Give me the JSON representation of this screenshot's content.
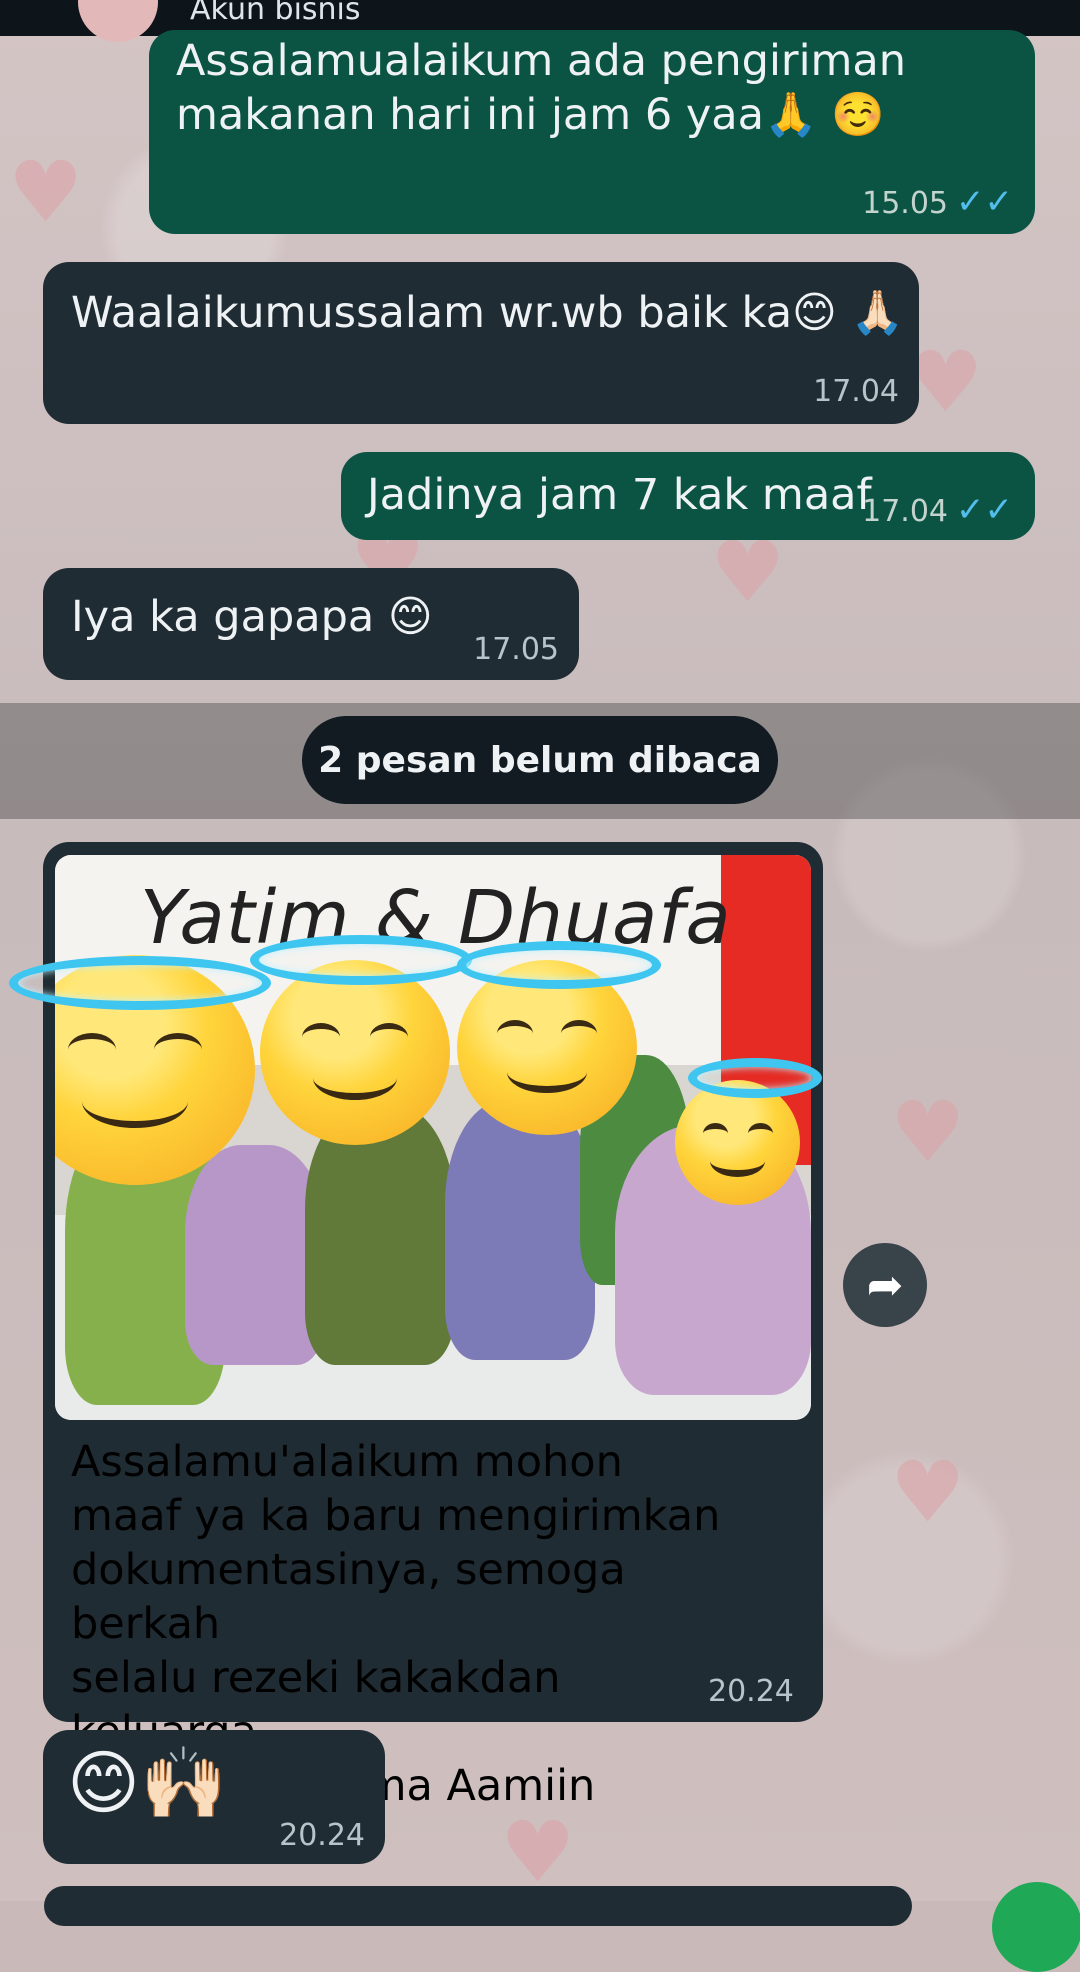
{
  "header": {
    "subtitle": "Akun bisnis"
  },
  "messages": [
    {
      "direction": "out",
      "text": "Assalamualaikum ada pengiriman makanan hari ini jam 6 yaa🙏 ☺️",
      "time": "15.05",
      "status": "read"
    },
    {
      "direction": "in",
      "text": "Waalaikumussalam wr.wb baik ka😊 🙏🏻",
      "time": "17.04"
    },
    {
      "direction": "out",
      "text": "Jadinya jam 7 kak maaf",
      "time": "17.04",
      "status": "read"
    },
    {
      "direction": "in",
      "text": "Iya ka gapapa 😊",
      "time": "17.05"
    }
  ],
  "unread_divider": "2 pesan belum dibaca",
  "photo_message": {
    "banner_text": "Yatim & Dhuafa",
    "caption_lines": [
      "Assalamu'alaikum mohon",
      "maaf ya ka baru mengirimkan",
      "dokumentasinya, semoga berkah",
      "selalu rezeki kakakdan keluarga.",
      "Aamiin allahuma Aamiin"
    ],
    "time": "20.24"
  },
  "last_message": {
    "text": "😊🙌🏻",
    "time": "20.24"
  },
  "icons": {
    "forward": "forward-icon",
    "read_ticks": "double-check-icon",
    "send": "send-icon"
  },
  "colors": {
    "incoming_bubble": "#202c33",
    "outgoing_bubble": "#0b5443",
    "read_tick": "#53bdeb",
    "send_button": "#1fa855"
  }
}
